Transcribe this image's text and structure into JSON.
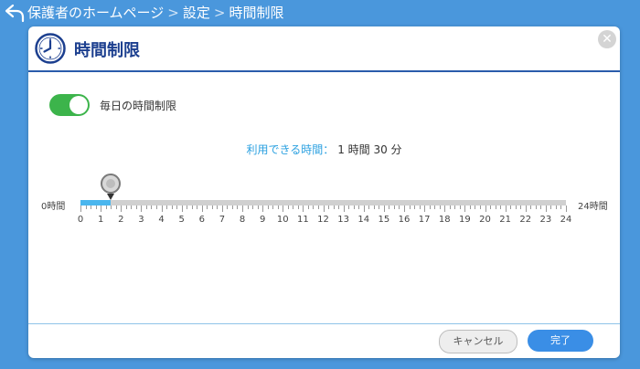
{
  "breadcrumb": {
    "items": [
      "保護者のホームページ",
      "設定",
      "時間制限"
    ],
    "separator": ">"
  },
  "dialog": {
    "title": "時間制限",
    "close_icon": "close-icon"
  },
  "toggle": {
    "label": "毎日の時間制限",
    "on": true,
    "color": "#3cb44b"
  },
  "availability": {
    "label": "利用できる時間：",
    "value": "1 時間 30 分"
  },
  "slider": {
    "min_label": "0時間",
    "max_label": "24時間",
    "tick_labels": [
      "0",
      "1",
      "2",
      "3",
      "4",
      "5",
      "6",
      "7",
      "8",
      "9",
      "10",
      "11",
      "12",
      "13",
      "14",
      "15",
      "16",
      "17",
      "18",
      "19",
      "20",
      "21",
      "22",
      "23",
      "24"
    ],
    "min": 0,
    "max": 24,
    "value_hours": 1.5,
    "fill_color": "#4ab6ee"
  },
  "footer": {
    "cancel_label": "キャンセル",
    "done_label": "完了",
    "accent": "#3a8ee6"
  }
}
